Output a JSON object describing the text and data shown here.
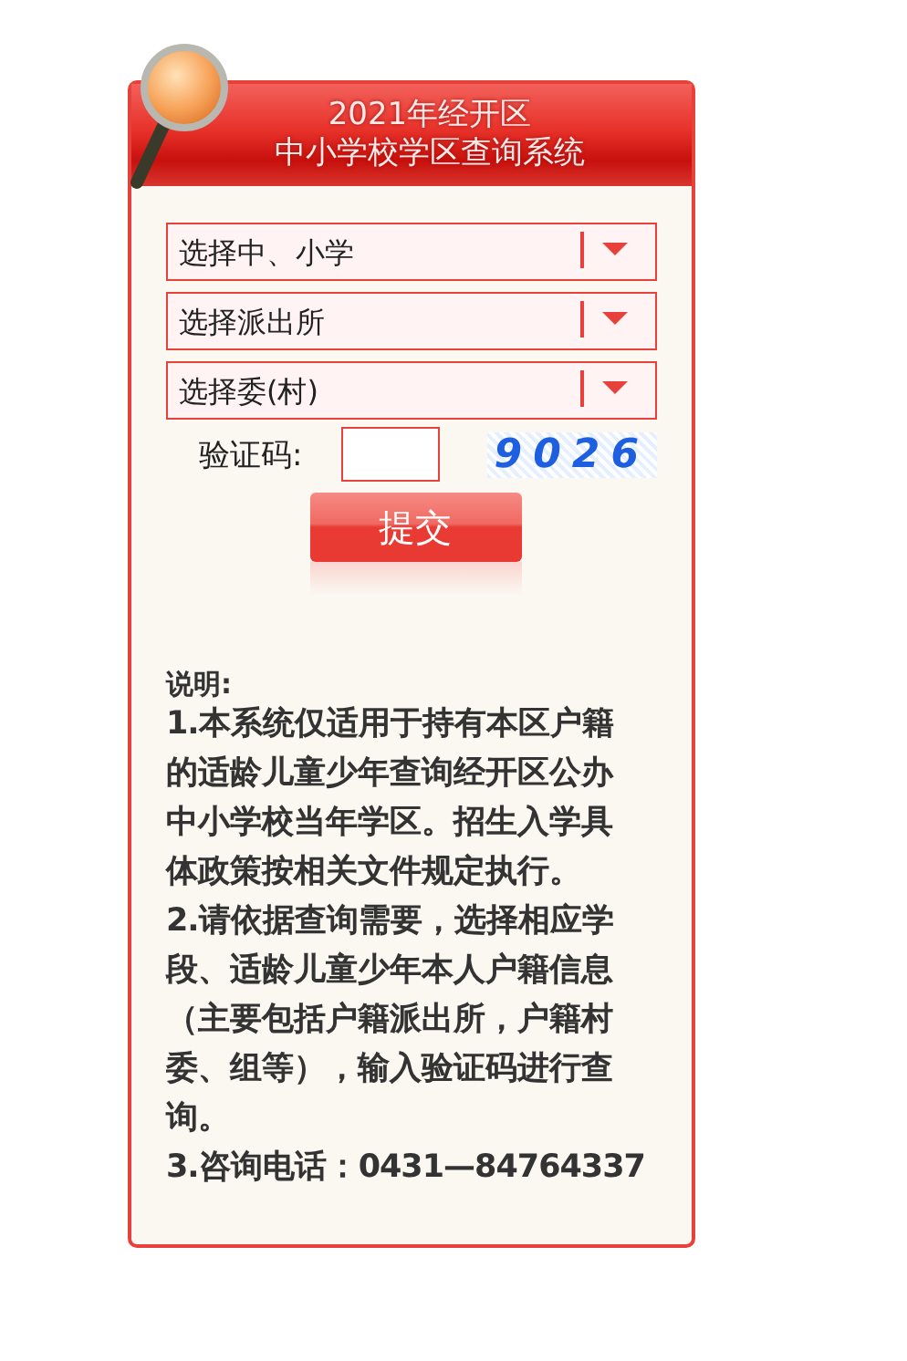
{
  "header": {
    "title_lines": [
      "2021年经开区",
      "中小学校学区查询系统"
    ]
  },
  "selects": [
    {
      "placeholder": "选择中、小学"
    },
    {
      "placeholder": "选择派出所"
    },
    {
      "placeholder": "选择委(村)"
    }
  ],
  "captcha": {
    "label": "验证码:",
    "code": "9026"
  },
  "submit": "提交",
  "notes": {
    "heading": "说明:",
    "lines": [
      "1.本系统仅适用于持有本区户籍",
      "的适龄儿童少年查询经开区公办",
      "中小学校当年学区。招生入学具",
      "体政策按相关文件规定执行。",
      "2.请依据查询需要，选择相应学",
      "段、适龄儿童少年本人户籍信息",
      "（主要包括户籍派出所，户籍村",
      "委、组等），输入验证码进行查",
      "询。",
      "3.咨询电话：**0431—84764337**"
    ]
  }
}
